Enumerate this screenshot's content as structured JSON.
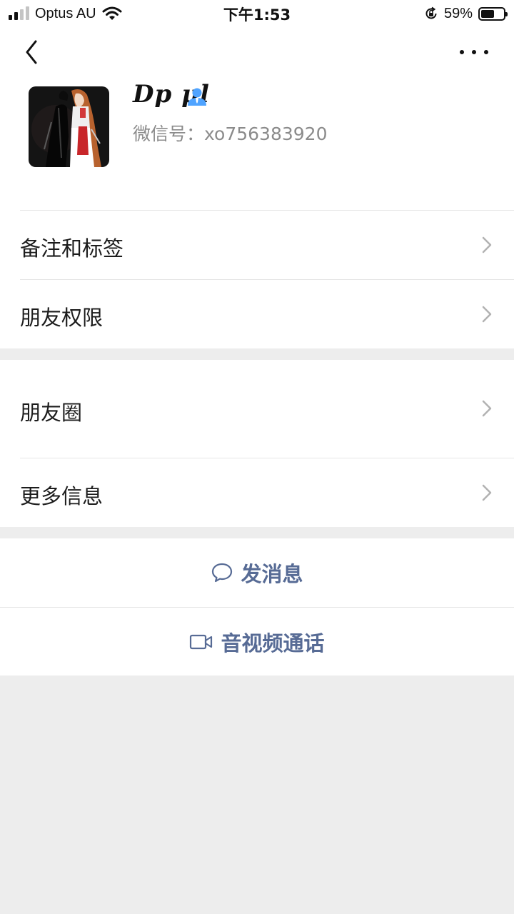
{
  "status_bar": {
    "carrier": "Optus AU",
    "time": "下午1:53",
    "battery_percent": "59%",
    "battery_level": 0.59,
    "signal_bars_filled": 2,
    "signal_bars_total": 4
  },
  "nav": {
    "back_icon": "chevron-left-icon",
    "more_icon": "more-dots-icon"
  },
  "profile": {
    "name": "Dp μl",
    "wechat_id": "微信号：xo756383920",
    "contact_icon": "contact-person-icon",
    "accent_color": "#4fa3ff"
  },
  "rows": {
    "remark_tags": "备注和标签",
    "friend_permissions": "朋友权限",
    "moments": "朋友圈",
    "more_info": "更多信息"
  },
  "actions": {
    "send_message": "发消息",
    "video_call": "音视频通话",
    "link_color": "#576b95"
  }
}
